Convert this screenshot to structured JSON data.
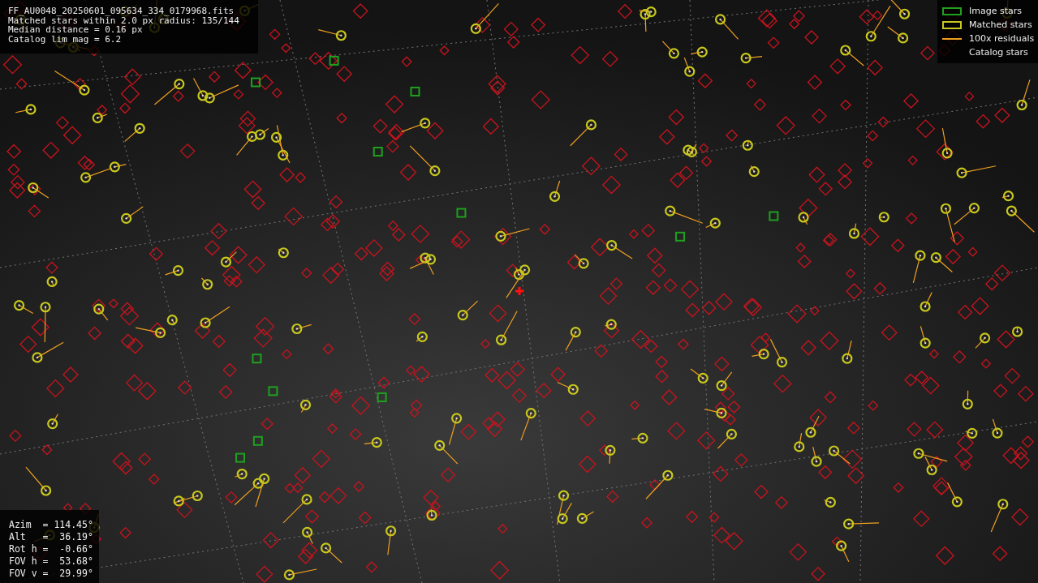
{
  "info_panel": {
    "lines": [
      "FF_AU0048_20250601_095634_334_0179968.fits",
      "Matched stars within 2.0 px radius: 135/144",
      "Median distance = 0.16 px",
      "Catalog lim mag = 6.2"
    ]
  },
  "legend": [
    {
      "label": "Image stars",
      "kind": "box",
      "color": "#1fa01f"
    },
    {
      "label": "Matched stars",
      "kind": "box",
      "color": "#c8c81e"
    },
    {
      "label": "100x residuals",
      "kind": "line",
      "color": "#f0a020"
    },
    {
      "label": "Catalog stars",
      "kind": "none"
    }
  ],
  "pointing_panel": {
    "lines": [
      "Azim  = 114.45°",
      "Alt   =  36.19°",
      "Rot h =  -0.66°",
      "FOV h =  53.68°",
      "FOV v =  29.99°"
    ]
  }
}
